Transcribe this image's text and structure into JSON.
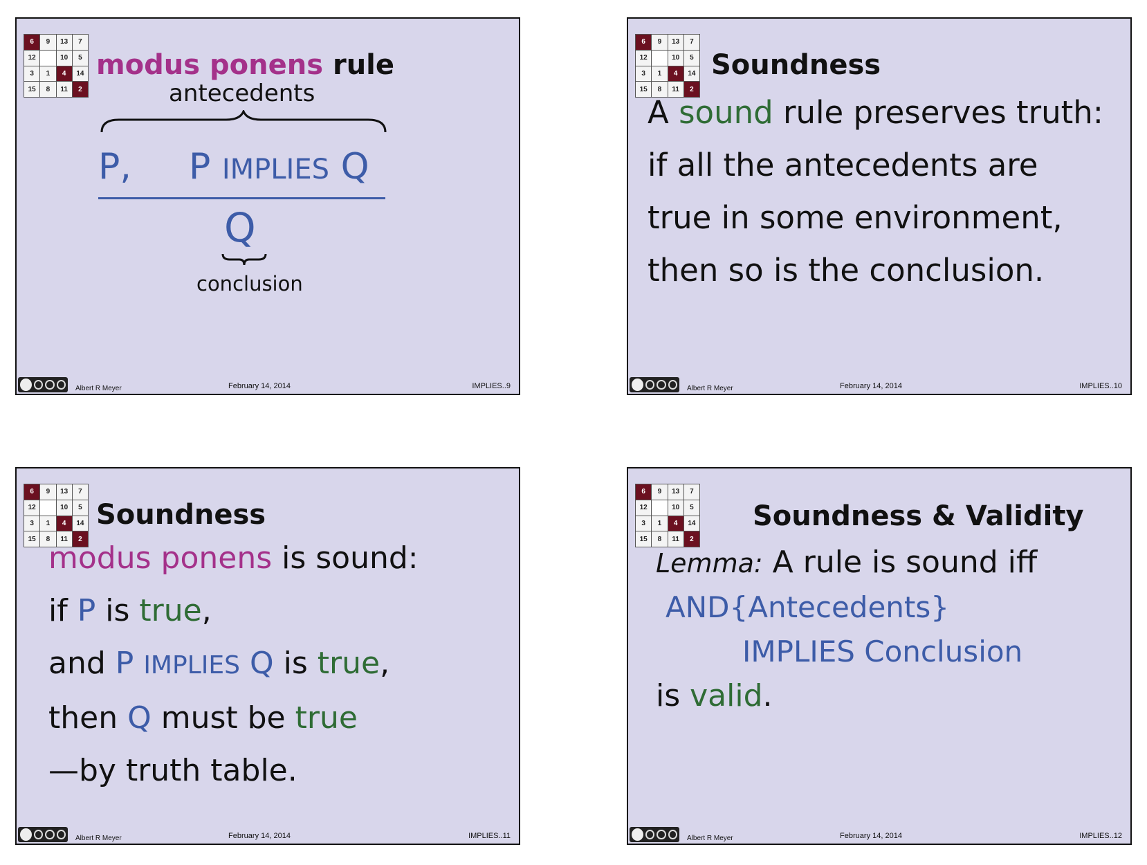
{
  "logo": {
    "cells": [
      "6",
      "9",
      "13",
      "7",
      "12",
      "",
      "10",
      "5",
      "3",
      "1",
      "4",
      "14",
      "15",
      "8",
      "11",
      "2"
    ]
  },
  "footer": {
    "author": "Albert R Meyer",
    "date": "February 14, 2014"
  },
  "slides": [
    {
      "title_word1": "modus",
      "title_word2": "ponens",
      "title_word3": "rule",
      "antecedents_label": "antecedents",
      "premise_p": "P,",
      "premise_implies_p": "P",
      "premise_implies_op": "IMPLIES",
      "premise_implies_q": "Q",
      "conclusion": "Q",
      "conclusion_label": "conclusion",
      "slide_number": "IMPLIES..9"
    },
    {
      "title": "Soundness",
      "line1_a": "A ",
      "line1_sound": "sound",
      "line1_b": " rule preserves truth:",
      "line2": "if all the antecedents are",
      "line3": "true in some environment,",
      "line4": "then so is the conclusion.",
      "slide_number": "IMPLIES..10"
    },
    {
      "title": "Soundness",
      "l1_mp": "modus ponens",
      "l1_rest": " is sound:",
      "l2_if": "if ",
      "l2_p": "P",
      "l2_is": " is ",
      "l2_true": "true",
      "l2_comma": ",",
      "l3_and": "and ",
      "l3_p": "P",
      "l3_implies": "IMPLIES",
      "l3_q": "Q",
      "l3_is": " is ",
      "l3_true": "true",
      "l3_comma": ",",
      "l4_then": "then ",
      "l4_q": "Q",
      "l4_must": " must be ",
      "l4_true": "true",
      "l5": "—by truth table.",
      "slide_number": "IMPLIES..11"
    },
    {
      "title": "Soundness & Validity",
      "lemma_label": "Lemma:",
      "lemma_text": " A rule is sound iff",
      "expr1": "AND{Antecedents}",
      "expr2": "IMPLIES Conclusion",
      "l4_is": "is ",
      "l4_valid": "valid",
      "l4_dot": ".",
      "slide_number": "IMPLIES..12"
    }
  ]
}
